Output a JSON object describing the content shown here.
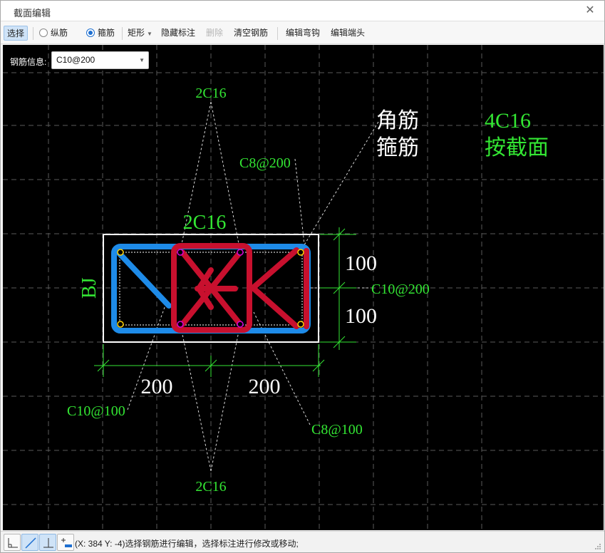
{
  "window": {
    "title": "截面编辑"
  },
  "toolbar": {
    "select": "选择",
    "longitudinal": "纵筋",
    "stirrup": "箍筋",
    "rect": "矩形",
    "hide_annot": "隐藏标注",
    "delete": "删除",
    "clear": "清空钢筋",
    "edit_hook": "编辑弯钩",
    "edit_end": "编辑端头"
  },
  "rebar_info": {
    "label": "钢筋信息:",
    "value": "C10@200"
  },
  "drawing": {
    "top_label": "2C16",
    "bottom_label": "2C16",
    "mid_label": "2C16",
    "corner_label_1": "角筋",
    "corner_label_2": "箍筋",
    "legend_1": "4C16",
    "legend_2": "按截面",
    "stirrup_top": "C8@200",
    "stirrup_right": "C10@200",
    "stirrup_bl": "C10@100",
    "stirrup_br": "C8@100",
    "bj": "BJ",
    "dim_h1": "100",
    "dim_h2": "100",
    "dim_w1": "200",
    "dim_w2": "200"
  },
  "status": {
    "text": "(X: 384 Y: -4)选择钢筋进行编辑，选择标注进行修改或移动;"
  },
  "colors": {
    "green": "#33e633",
    "blue": "#1e8be8",
    "red": "#c8102e",
    "canvas": "#000000"
  }
}
